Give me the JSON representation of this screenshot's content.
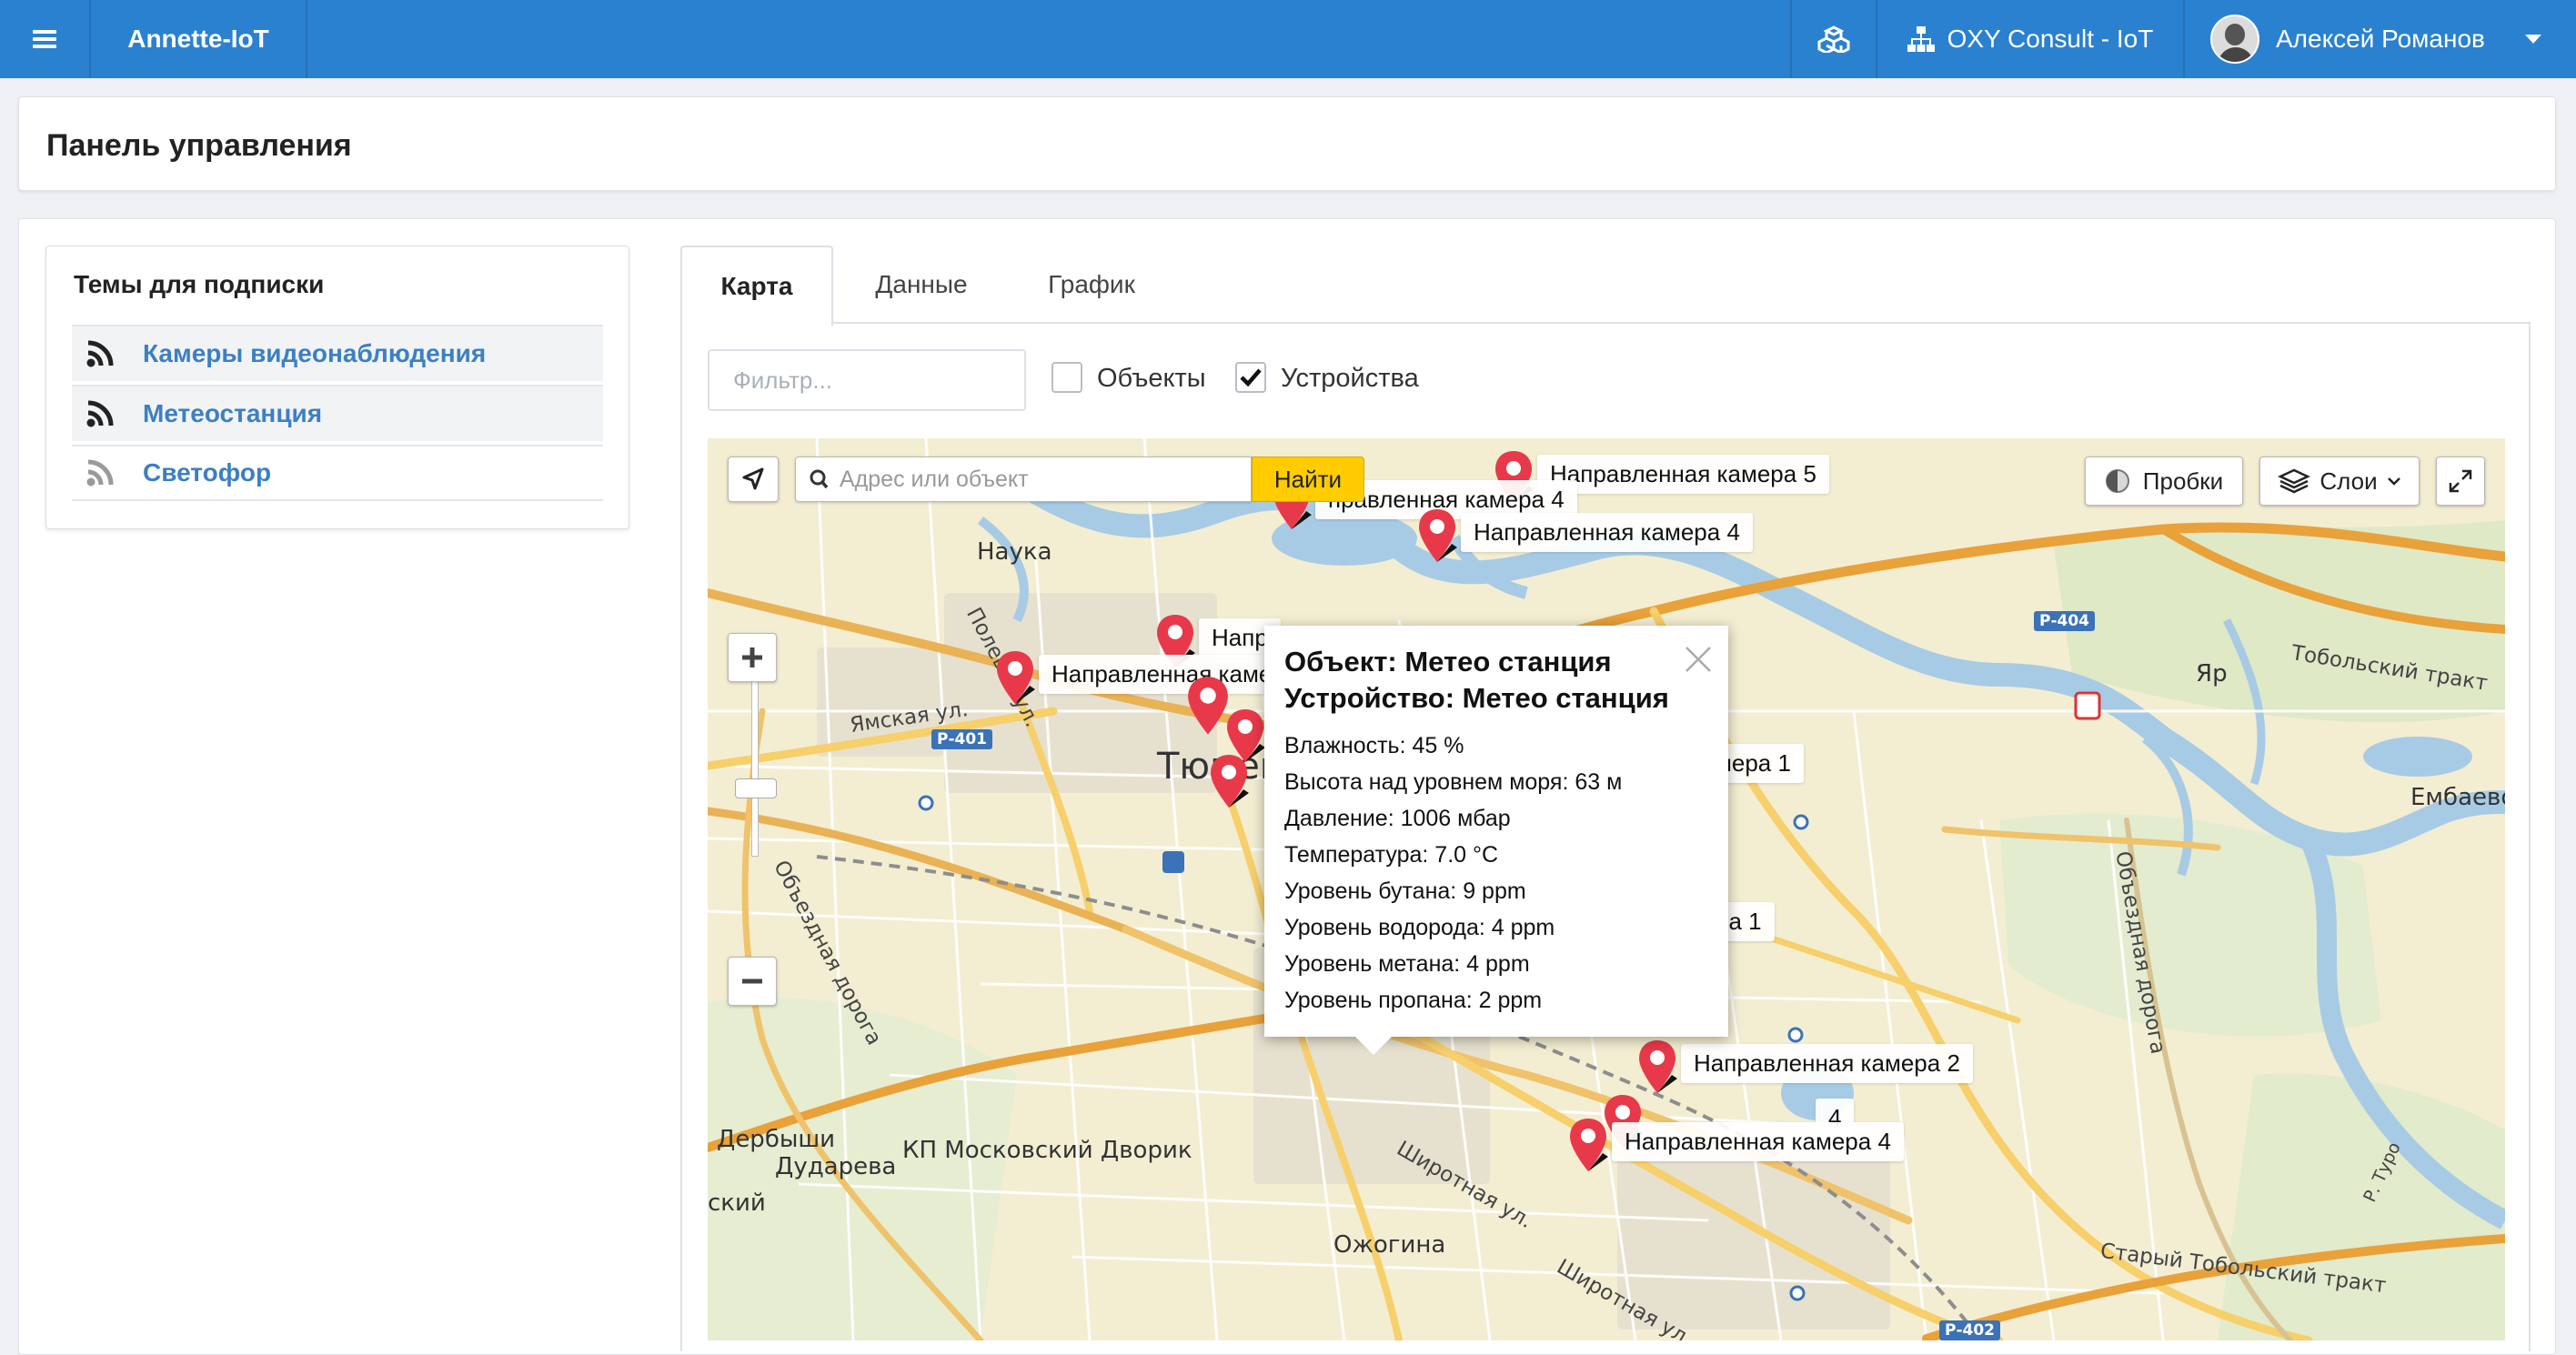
{
  "topbar": {
    "brand": "Annette-IoT",
    "org": "OXY Consult - IoT",
    "user": "Алексей Романов",
    "icons": [
      "menu-icon",
      "cubes-icon",
      "sitemap-icon",
      "caret-down-icon"
    ]
  },
  "page": {
    "title": "Панель управления"
  },
  "subscriptions": {
    "title": "Темы для подписки",
    "items": [
      {
        "label": "Камеры видеонаблюдения",
        "icon": "rss-icon",
        "active": true
      },
      {
        "label": "Метеостанция",
        "icon": "rss-icon",
        "active": true
      },
      {
        "label": "Светофор",
        "icon": "rss-icon",
        "active": false
      }
    ]
  },
  "tabs": {
    "items": [
      "Карта",
      "Данные",
      "График"
    ],
    "selected": "Карта"
  },
  "filters": {
    "placeholder": "Фильтр...",
    "objects_label": "Объекты",
    "objects_checked": false,
    "devices_label": "Устройства",
    "devices_checked": true
  },
  "map": {
    "search_placeholder": "Адрес или объект",
    "find_label": "Найти",
    "traffic_label": "Пробки",
    "layers_label": "Слои",
    "places": [
      "Наука",
      "Полевая ул.",
      "Ямская ул.",
      "Тюмень",
      "Яр",
      "Тобольский тракт",
      "Ембаево",
      "Объездная дорога",
      "Объездная дорога",
      "Дербыши",
      "Дударева",
      "КП Московский Дворик",
      "ский",
      "Ожогина",
      "Широтная ул.",
      "Широтная ул.",
      "Старый Тобольский тракт",
      "Р. Туро"
    ],
    "shields": [
      "Р-401",
      "Р-404",
      "Р-402"
    ],
    "markers": [
      {
        "label": "Направленная камера 5"
      },
      {
        "label": "правленная камера 4"
      },
      {
        "label": "Направленная камера 4"
      },
      {
        "label": "Напр"
      },
      {
        "label": "Направленная каме"
      },
      {
        "label": "мера 1"
      },
      {
        "label": "ра 1"
      },
      {
        "label": "Направленная камера 2"
      },
      {
        "label": "4"
      },
      {
        "label": "Направленная камера 4"
      }
    ],
    "popup": {
      "object": "Объект: Метео станция",
      "device": "Устройство: Метео станция",
      "rows": [
        "Влажность: 45 %",
        "Высота над уровнем моря: 63 м",
        "Давление: 1006 мбар",
        "Температура: 7.0 °C",
        "Уровень бутана: 9 ppm",
        "Уровень водорода: 4 ppm",
        "Уровень метана: 4 ppm",
        "Уровень пропана: 2 ppm"
      ]
    }
  }
}
